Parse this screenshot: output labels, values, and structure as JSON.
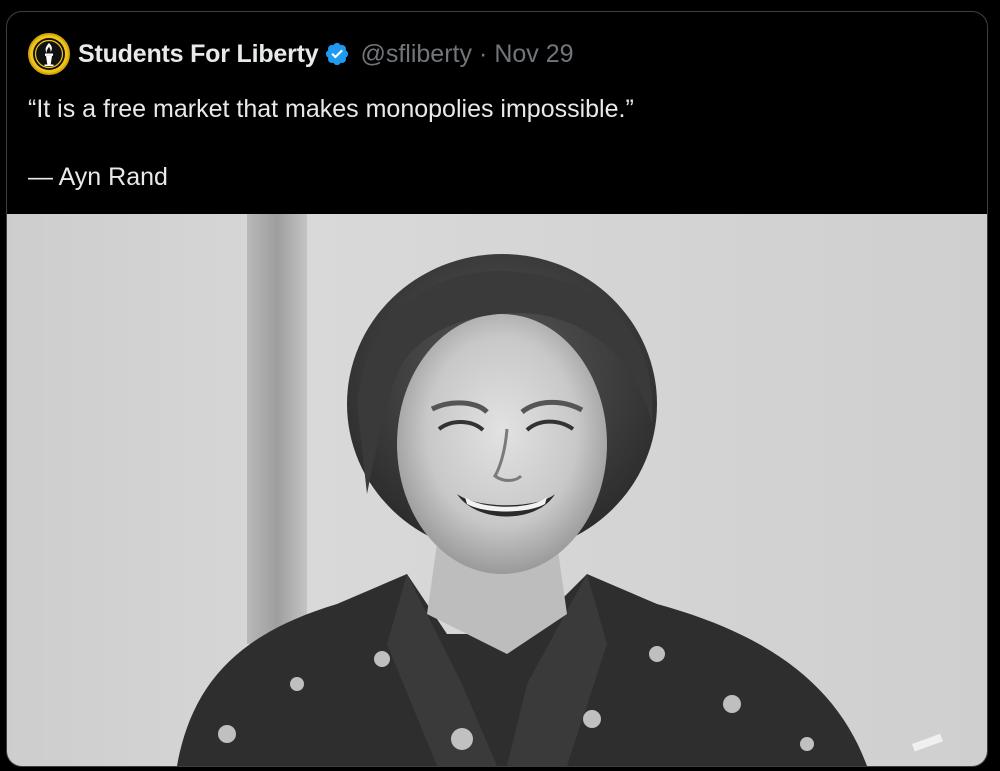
{
  "tweet": {
    "display_name": "Students For Liberty",
    "verified": true,
    "handle": "@sfliberty",
    "separator": "·",
    "date": "Nov 29",
    "text_quote": "“It is a free market that makes monopolies impossible.”",
    "text_attribution": "— Ayn Rand",
    "avatar_icon": "torch-logo-icon",
    "media_description_icon": "portrait-photo"
  },
  "colors": {
    "background": "#000000",
    "text": "#e7e9ea",
    "secondary_text": "#71767b",
    "verified_blue": "#1d9bf0",
    "avatar_gold": "#f0c419"
  }
}
